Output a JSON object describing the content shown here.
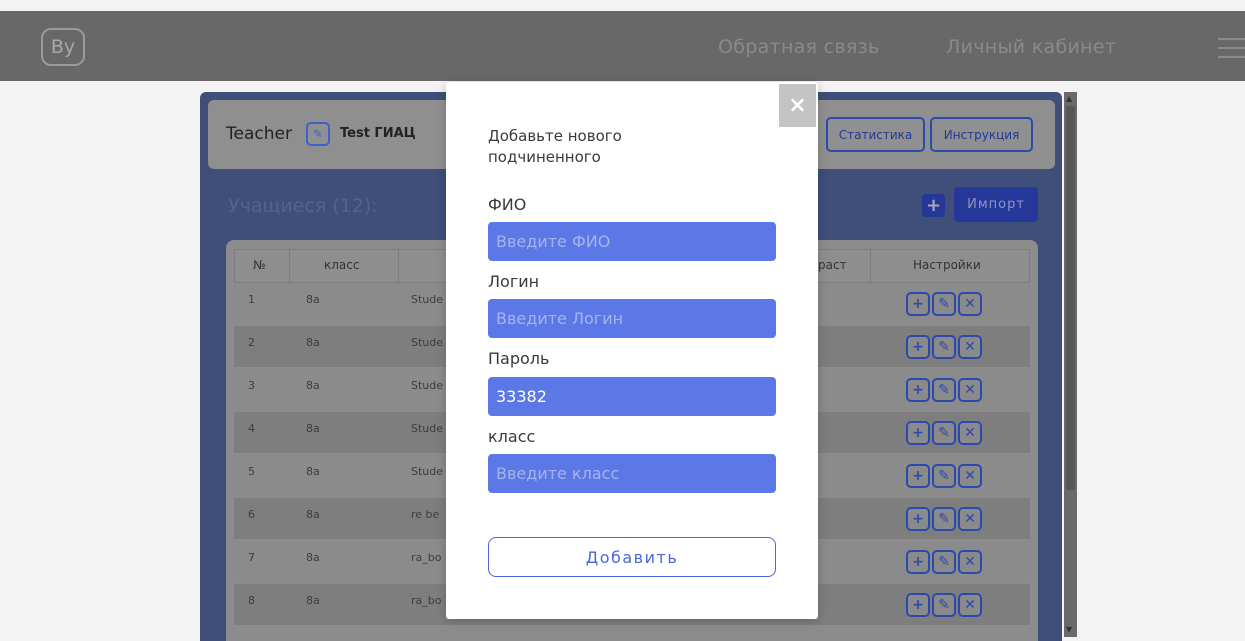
{
  "header": {
    "logo": "By",
    "nav": [
      "Обратная связь",
      "Личный кабинет"
    ]
  },
  "teacher": {
    "label": "Teacher",
    "name": "Test ГИАЦ",
    "buttons": [
      "Статистика",
      "Инструкция"
    ]
  },
  "students": {
    "title": "Учащиеся (12):",
    "plus": "+",
    "import_label": "Импорт"
  },
  "table": {
    "columns": [
      "№",
      "класс",
      "раст",
      "Настройки"
    ],
    "rows": [
      [
        "1",
        "8а",
        "Stude"
      ],
      [
        "2",
        "8а",
        "Stude"
      ],
      [
        "3",
        "8а",
        "Stude"
      ],
      [
        "4",
        "8а",
        "Stude"
      ],
      [
        "5",
        "8а",
        "Stude"
      ],
      [
        "6",
        "8а",
        "re be"
      ],
      [
        "7",
        "8а",
        "ra_bo"
      ],
      [
        "8",
        "8а",
        "ra_bo"
      ]
    ]
  },
  "modal": {
    "close": "×",
    "title": "Добавьте нового подчиненного",
    "fio_label": "ФИО",
    "fio_placeholder": "Введите ФИО",
    "login_label": "Логин",
    "login_placeholder": "Введите Логин",
    "password_label": "Пароль",
    "password_value": "33382",
    "class_label": "класс",
    "class_placeholder": "Введите класс",
    "submit": "Добавить"
  },
  "colors": {
    "accent": "#5b78e6",
    "overlay": "#686868"
  }
}
